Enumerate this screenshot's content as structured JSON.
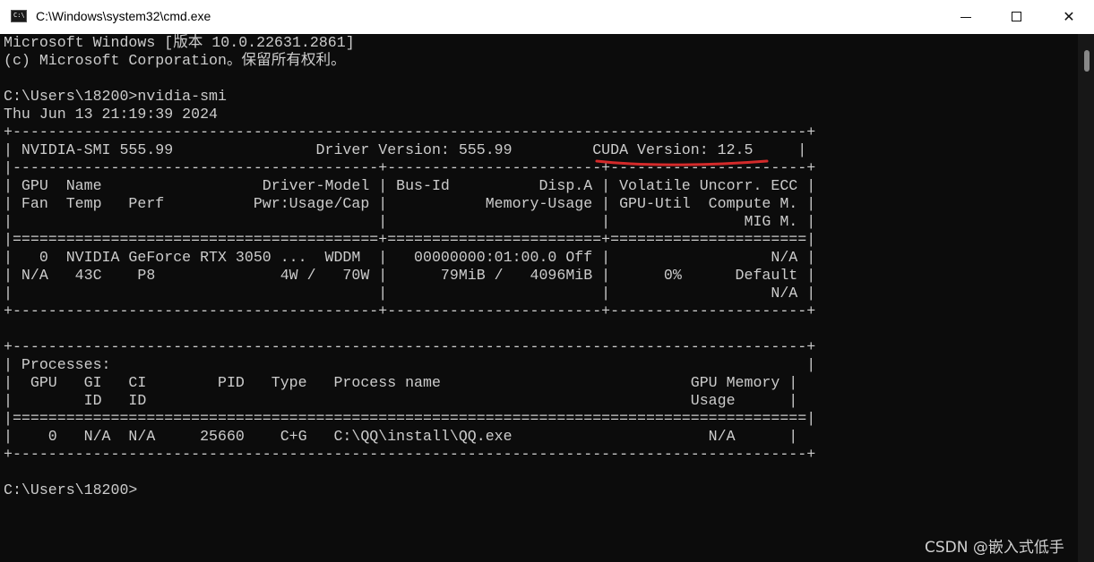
{
  "window": {
    "title": "C:\\Windows\\system32\\cmd.exe",
    "icon_label": "C:\\",
    "minimize_icon": "minimize-icon",
    "maximize_icon": "maximize-icon",
    "close_glyph": "✕"
  },
  "terminal": {
    "lines": [
      "Microsoft Windows [版本 10.0.22631.2861]",
      "(c) Microsoft Corporation。保留所有权利。",
      "",
      "C:\\Users\\18200>nvidia-smi",
      "Thu Jun 13 21:19:39 2024",
      "+-----------------------------------------------------------------------------------------+",
      "| NVIDIA-SMI 555.99                Driver Version: 555.99         CUDA Version: 12.5     |",
      "|-----------------------------------------+------------------------+----------------------+",
      "| GPU  Name                  Driver-Model | Bus-Id          Disp.A | Volatile Uncorr. ECC |",
      "| Fan  Temp   Perf          Pwr:Usage/Cap |           Memory-Usage | GPU-Util  Compute M. |",
      "|                                         |                        |               MIG M. |",
      "|=========================================+========================+======================|",
      "|   0  NVIDIA GeForce RTX 3050 ...  WDDM  |   00000000:01:00.0 Off |                  N/A |",
      "| N/A   43C    P8              4W /   70W |      79MiB /   4096MiB |      0%      Default |",
      "|                                         |                        |                  N/A |",
      "+-----------------------------------------+------------------------+----------------------+",
      "",
      "+-----------------------------------------------------------------------------------------+",
      "| Processes:                                                                              |",
      "|  GPU   GI   CI        PID   Type   Process name                            GPU Memory |",
      "|        ID   ID                                                             Usage      |",
      "|=========================================================================================|",
      "|    0   N/A  N/A     25660    C+G   C:\\QQ\\install\\QQ.exe                      N/A      |",
      "+-----------------------------------------------------------------------------------------+",
      "",
      "C:\\Users\\18200>"
    ]
  },
  "annotation": {
    "underline_color": "#d42a2a"
  },
  "watermark": {
    "text": "CSDN @嵌入式低手"
  }
}
